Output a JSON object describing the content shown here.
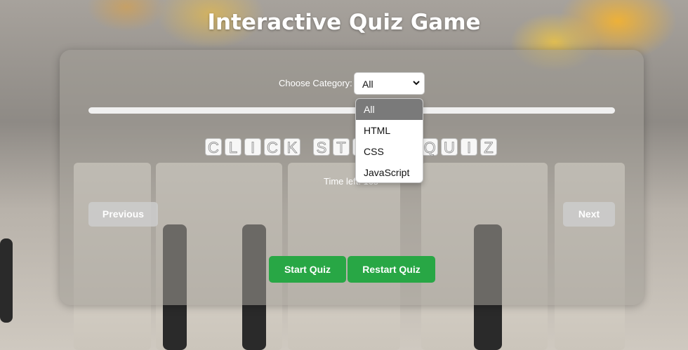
{
  "page": {
    "title": "Interactive Quiz Game"
  },
  "category": {
    "label": "Choose Category:",
    "selected": "All",
    "options": [
      "All",
      "HTML",
      "CSS",
      "JavaScript"
    ],
    "chevron_icon": "chevron-down-icon"
  },
  "progress": {
    "fraction": 0.0,
    "color": "#28a745"
  },
  "banner": {
    "letters": [
      "C",
      "L",
      "I",
      "C",
      "K",
      " ",
      "S",
      "T",
      "A",
      "R",
      "T",
      " ",
      "Q",
      "U",
      "I",
      "Z"
    ]
  },
  "timer": {
    "text": "Time left: 10s"
  },
  "nav": {
    "previous_label": "Previous",
    "next_label": "Next"
  },
  "actions": {
    "start_label": "Start Quiz",
    "restart_label": "Restart Quiz",
    "accent": "#28a745"
  }
}
